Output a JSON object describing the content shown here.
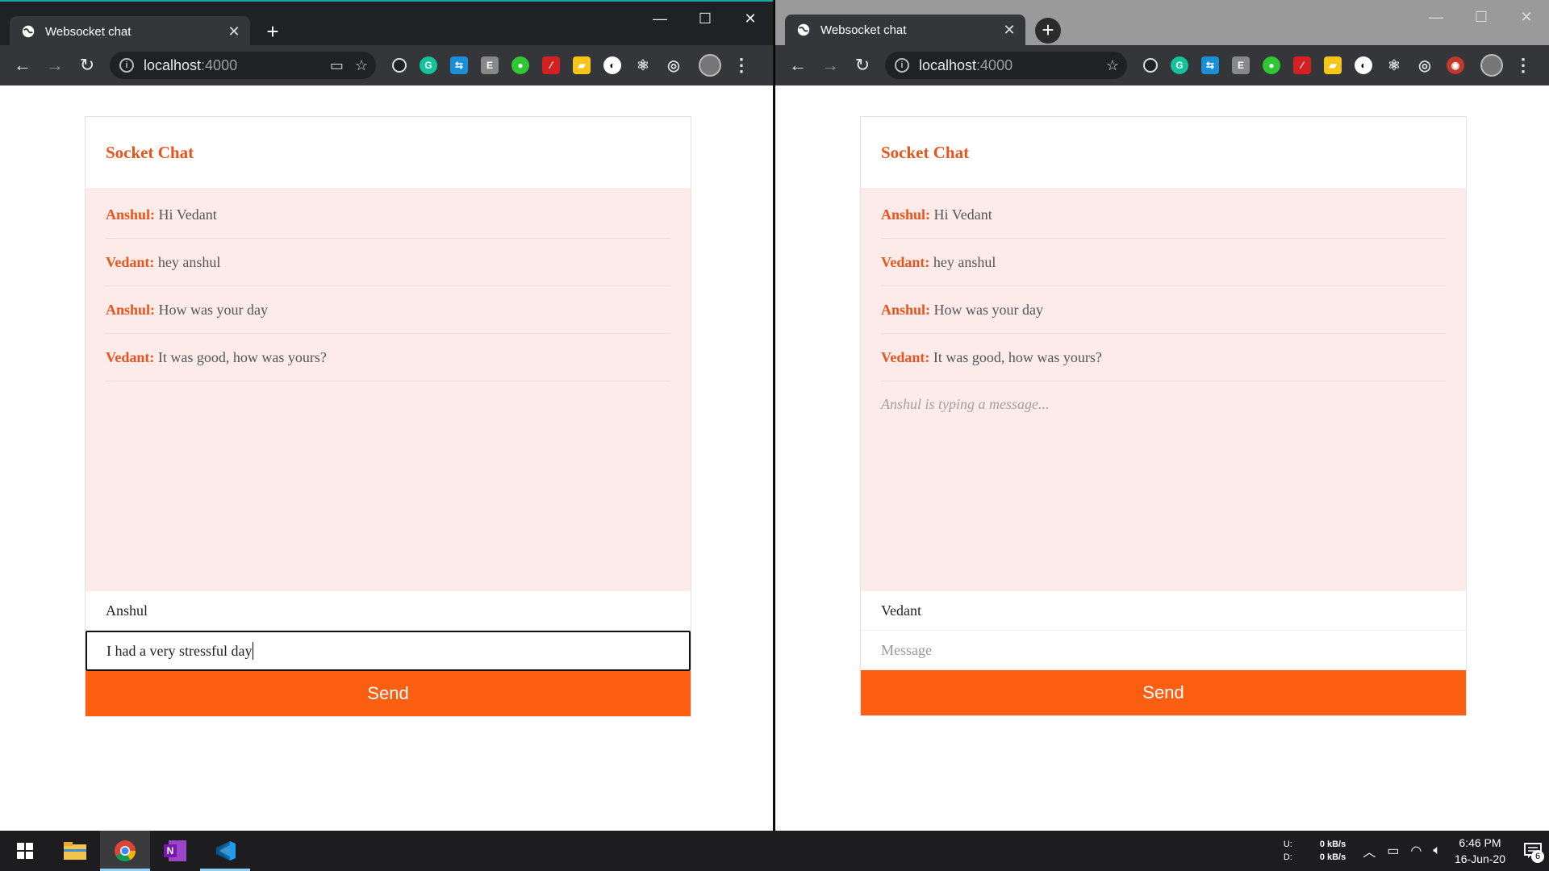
{
  "browser": {
    "tab_title": "Websocket chat",
    "url_host": "localhost",
    "url_port": ":4000"
  },
  "left_window": {
    "chat": {
      "title": "Socket Chat",
      "messages": [
        {
          "sender": "Anshul:",
          "text": "Hi Vedant"
        },
        {
          "sender": "Vedant:",
          "text": "hey anshul"
        },
        {
          "sender": "Anshul:",
          "text": "How was your day"
        },
        {
          "sender": "Vedant:",
          "text": "It was good, how was yours?"
        }
      ],
      "handle_value": "Anshul",
      "message_value": "I had a very stressful day",
      "send_label": "Send"
    }
  },
  "right_window": {
    "chat": {
      "title": "Socket Chat",
      "messages": [
        {
          "sender": "Anshul:",
          "text": "Hi Vedant"
        },
        {
          "sender": "Vedant:",
          "text": "hey anshul"
        },
        {
          "sender": "Anshul:",
          "text": "How was your day"
        },
        {
          "sender": "Vedant:",
          "text": "It was good, how was yours?"
        }
      ],
      "typing_indicator": "Anshul is typing a message...",
      "handle_value": "Vedant",
      "message_placeholder": "Message",
      "send_label": "Send"
    }
  },
  "taskbar": {
    "net_upload_label": "U:",
    "net_download_label": "D:",
    "net_upload_value": "0 kB/s",
    "net_download_value": "0 kB/s",
    "time": "6:46 PM",
    "date": "16-Jun-20",
    "notification_count": "6"
  },
  "colors": {
    "accent": "#fd5f12",
    "title": "#e8541b",
    "chat_bg": "#fdebea"
  }
}
